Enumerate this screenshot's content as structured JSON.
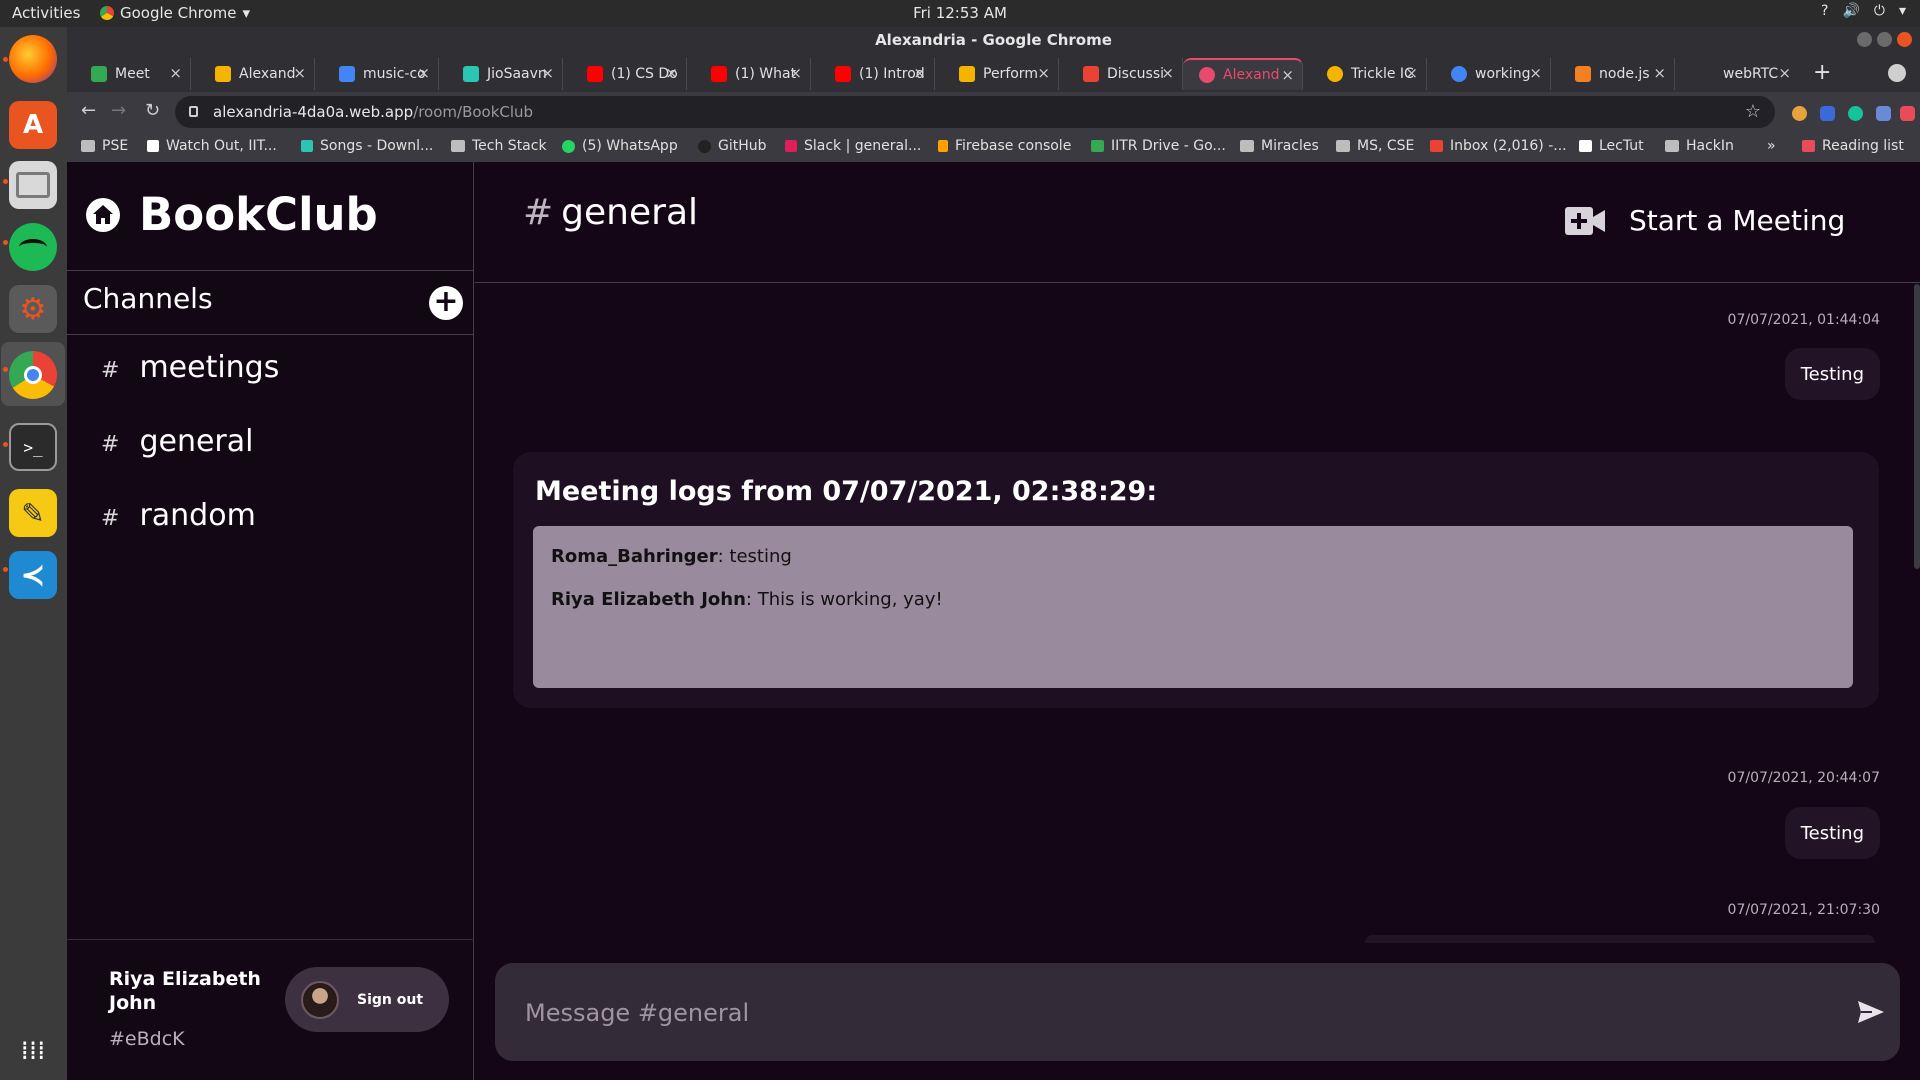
{
  "system": {
    "activities": "Activities",
    "app_menu": "Google Chrome",
    "clock": "Fri 12:53 AM",
    "tray": [
      "?",
      "🔊",
      "⏻",
      "▾"
    ]
  },
  "chrome": {
    "window_title": "Alexandria - Google Chrome",
    "tabs": [
      {
        "label": "Meet",
        "color": "#34a853"
      },
      {
        "label": "Alexand",
        "color": "#f6b400"
      },
      {
        "label": "music-co",
        "color": "#4285f4"
      },
      {
        "label": "JioSaavn",
        "color": "#2bc5b4"
      },
      {
        "label": "(1) CS Do",
        "color": "#ff0000"
      },
      {
        "label": "(1) What",
        "color": "#ff0000"
      },
      {
        "label": "(1) Introd",
        "color": "#ff0000"
      },
      {
        "label": "Perform",
        "color": "#f6b400"
      },
      {
        "label": "Discussi",
        "color": "#ea4335"
      },
      {
        "label": "Alexand",
        "color": "#e84a6b"
      },
      {
        "label": "Trickle IC",
        "color": "#f4b400"
      },
      {
        "label": "working",
        "color": "#4285f4"
      },
      {
        "label": "node.js",
        "color": "#f48024"
      },
      {
        "label": "webRTC",
        "color": "#888888"
      }
    ],
    "url_host": "alexandria-4da0a.web.app",
    "url_path": "/room/BookClub",
    "bookmarks": [
      "PSE",
      "Watch Out, IIT...",
      "Songs - Downl...",
      "Tech Stack",
      "(5) WhatsApp",
      "GitHub",
      "Slack | general...",
      "Firebase console",
      "IITR Drive - Go...",
      "Miracles",
      "MS, CSE",
      "Inbox (2,016) -...",
      "LecTut",
      "HackIn"
    ],
    "more_bookmarks": "»",
    "reading_list": "Reading list"
  },
  "app": {
    "brand": "BookClub",
    "channels_heading": "Channels",
    "channels": [
      "meetings",
      "general",
      "random"
    ],
    "user": {
      "name": "Riya Elizabeth John",
      "tag": "#eBdcK",
      "signout": "Sign out"
    },
    "current_channel": "general",
    "channel_hash": "#",
    "start_meeting": "Start a Meeting",
    "messages": [
      {
        "timestamp": "07/07/2021, 01:44:04",
        "text": "Testing"
      },
      {
        "timestamp": "07/07/2021, 20:44:07",
        "text": "Testing"
      },
      {
        "timestamp": "07/07/2021, 21:07:30",
        "text": ""
      }
    ],
    "meeting_log": {
      "title": "Meeting logs from 07/07/2021, 02:38:29:",
      "entries": [
        {
          "author": "Roma_Bahringer",
          "text": ": testing"
        },
        {
          "author": "Riya Elizabeth John",
          "text": ": This is working, yay!"
        }
      ]
    },
    "composer_placeholder": "Message #general"
  }
}
